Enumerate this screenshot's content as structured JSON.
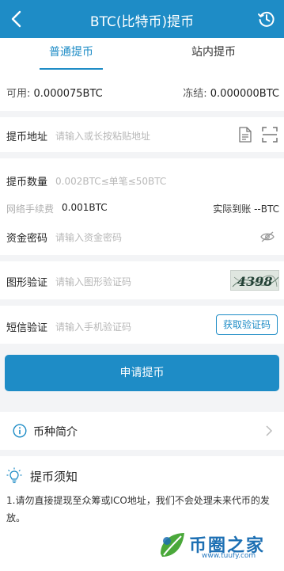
{
  "header": {
    "title": "BTC(比特币)提币",
    "back_icon": "back-chevron-icon",
    "history_icon": "clock-history-icon"
  },
  "tabs": [
    {
      "label": "普通提币",
      "active": true
    },
    {
      "label": "站内提币",
      "active": false
    }
  ],
  "balance": {
    "available_label": "可用: ",
    "available_value": "0.000075BTC",
    "frozen_label": "冻结: ",
    "frozen_value": "0.000000BTC"
  },
  "form": {
    "address": {
      "label": "提币地址",
      "placeholder": "请输入或长按粘贴地址"
    },
    "amount": {
      "label": "提币数量",
      "placeholder": "0.002BTC≤单笔≤50BTC"
    },
    "fee": {
      "label": "网络手续费",
      "value": "0.001BTC",
      "arrive_label": "实际到账",
      "arrive_value": "--BTC"
    },
    "password": {
      "label": "资金密码",
      "placeholder": "请输入资金密码"
    },
    "captcha": {
      "label": "图形验证",
      "placeholder": "请输入图形验证码",
      "image_text": "4398"
    },
    "sms": {
      "label": "短信验证",
      "placeholder": "请输入手机验证码",
      "button": "获取验证码"
    }
  },
  "submit_button": "申请提币",
  "intro": {
    "label": "币种简介"
  },
  "notice": {
    "title": "提币须知",
    "text": "1.请勿直接提现至众筹或ICO地址，我们不会处理未来代币的发放。"
  },
  "watermark": {
    "name": "币圈之家",
    "url": "www.tuufy.com"
  },
  "colors": {
    "primary": "#1e8cc6",
    "background": "#f3f4f6"
  }
}
